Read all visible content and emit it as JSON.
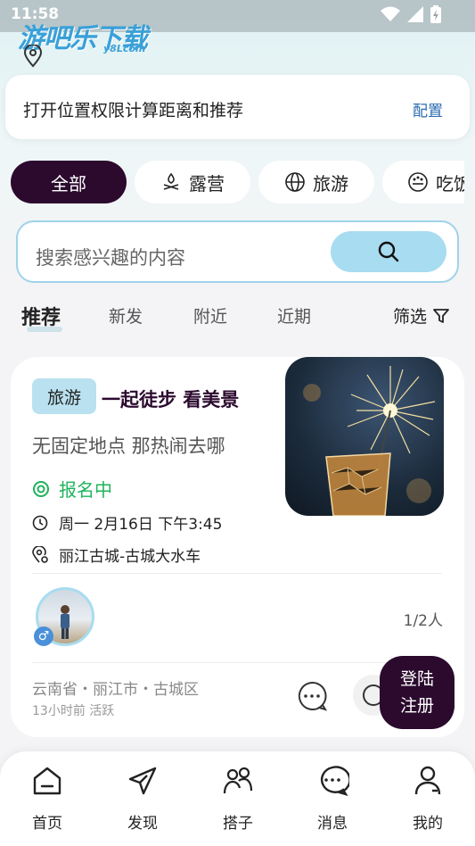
{
  "status_bar": {
    "time": "11:58"
  },
  "logo": {
    "text": "游吧乐下载",
    "sub": "y8Lcom"
  },
  "permission_banner": {
    "text": "打开位置权限计算距离和推荐",
    "action": "配置"
  },
  "categories": [
    {
      "label": "全部",
      "icon": "",
      "active": true
    },
    {
      "label": "露营",
      "icon": "camping-icon"
    },
    {
      "label": "旅游",
      "icon": "globe-icon"
    },
    {
      "label": "吃饭",
      "icon": "food-icon"
    }
  ],
  "search": {
    "placeholder": "搜索感兴趣的内容",
    "icon": "search-icon"
  },
  "tabs": [
    {
      "label": "推荐",
      "active": true
    },
    {
      "label": "新发"
    },
    {
      "label": "附近"
    },
    {
      "label": "近期"
    }
  ],
  "filter": {
    "label": "筛选",
    "icon": "filter-icon"
  },
  "post": {
    "tag": "旅游",
    "title": "一起徒步 看美景",
    "subtitle": "无固定地点 那热闹去哪",
    "status": "报名中",
    "datetime": "周一 2月16日 下午3:45",
    "place": "丽江古城-古城大水车",
    "participants": "1/2人",
    "gender": "♂",
    "location": "云南省・丽江市・古城区",
    "activity": "13小时前 活跃"
  },
  "fab": {
    "line1": "登陆",
    "line2": "注册"
  },
  "bottom_nav": [
    {
      "label": "首页",
      "icon": "home-icon"
    },
    {
      "label": "发现",
      "icon": "discover-icon"
    },
    {
      "label": "搭子",
      "icon": "partners-icon"
    },
    {
      "label": "消息",
      "icon": "message-icon"
    },
    {
      "label": "我的",
      "icon": "profile-icon"
    }
  ],
  "colors": {
    "primary": "#2b0a2e",
    "accent": "#a8dcf0",
    "success": "#1fb35c",
    "link": "#2b6cb0"
  }
}
